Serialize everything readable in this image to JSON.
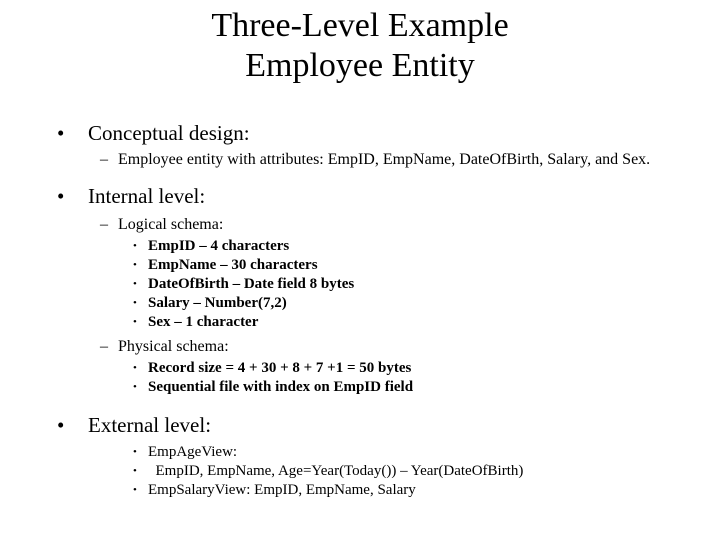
{
  "slide": {
    "title": {
      "line1": "Three-Level Example",
      "line2": "Employee Entity"
    },
    "markers": {
      "level1_bullet": "•",
      "level2_bullet": "–",
      "level3_bullet": "•"
    },
    "content": [
      {
        "level": 1,
        "text": "Conceptual design:"
      },
      {
        "level": 2,
        "text": "Employee entity with attributes: EmpID, EmpName, DateOfBirth, Salary, and Sex."
      },
      {
        "level": 1,
        "text": "Internal level:"
      },
      {
        "level": 2,
        "text": "Logical schema:"
      },
      {
        "level": 3,
        "text": "EmpID – 4 characters"
      },
      {
        "level": 3,
        "text": "EmpName – 30 characters"
      },
      {
        "level": 3,
        "text": "DateOfBirth – Date field 8 bytes"
      },
      {
        "level": 3,
        "text": "Salary – Number(7,2)"
      },
      {
        "level": 3,
        "text": "Sex – 1 character"
      },
      {
        "level": 2,
        "text": "Physical schema:"
      },
      {
        "level": 3,
        "text": "Record size = 4 + 30 + 8 + 7 +1 = 50 bytes"
      },
      {
        "level": 3,
        "text": "Sequential file with index on EmpID field"
      },
      {
        "level": 1,
        "text": "External level:"
      },
      {
        "level": 3,
        "text": "EmpAgeView:"
      },
      {
        "level": 3,
        "text": "  EmpID, EmpName, Age=Year(Today()) – Year(DateOfBirth)"
      },
      {
        "level": 3,
        "text": "EmpSalaryView: EmpID, EmpName, Salary"
      }
    ],
    "colors": {
      "background": "#ffffff",
      "text": "#000000"
    }
  }
}
